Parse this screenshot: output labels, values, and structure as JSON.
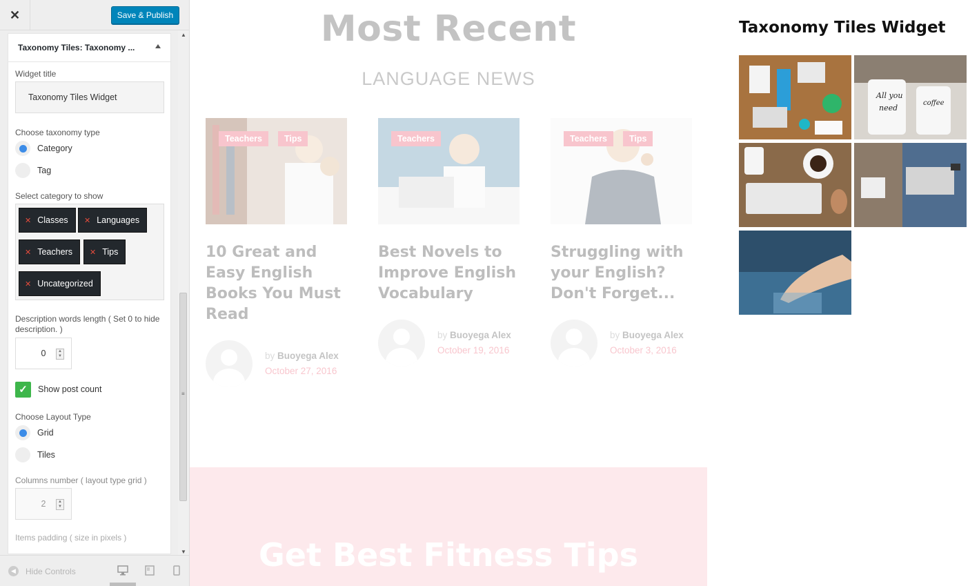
{
  "customizer": {
    "close_label": "✕",
    "save_label": "Save & Publish",
    "panel_title": "Taxonomy Tiles: Taxonomy ...",
    "widget_title_label": "Widget title",
    "widget_title_value": "Taxonomy Tiles Widget",
    "taxonomy_type_label": "Choose taxonomy type",
    "taxonomy_options": [
      "Category",
      "Tag"
    ],
    "taxonomy_selected": "Category",
    "select_category_label": "Select category to show",
    "categories": [
      "Classes",
      "Languages",
      "Teachers",
      "Tips",
      "Uncategorized"
    ],
    "desc_length_label": "Description words length ( Set 0 to hide description. )",
    "desc_length_value": "0",
    "show_post_count_label": "Show post count",
    "show_post_count": true,
    "layout_type_label": "Choose Layout Type",
    "layout_options": [
      "Grid",
      "Tiles"
    ],
    "layout_selected": "Grid",
    "columns_label": "Columns number ( layout type grid )",
    "columns_value": "2",
    "padding_label": "Items padding ( size in pixels )",
    "hide_controls_label": "Hide Controls"
  },
  "preview": {
    "heading": "Most Recent",
    "subheading": "LANGUAGE NEWS",
    "posts": [
      {
        "tags": [
          "Teachers",
          "Tips"
        ],
        "title": "10 Great and Easy English Books You Must Read",
        "by": "by",
        "author": "Buoyega Alex",
        "date": "October 27, 2016"
      },
      {
        "tags": [
          "Teachers"
        ],
        "title": "Best Novels to Improve English Vocabulary",
        "by": "by",
        "author": "Buoyega Alex",
        "date": "October 19, 2016"
      },
      {
        "tags": [
          "Teachers",
          "Tips"
        ],
        "title": "Struggling with your English? Don't Forget...",
        "by": "by",
        "author": "Buoyega Alex",
        "date": "October 3, 2016"
      }
    ],
    "banner_text": "Get Best Fitness Tips",
    "widget_heading": "Taxonomy Tiles Widget",
    "tiles": [
      "desk-workspace-photo",
      "coffee-mugs-photo",
      "keyboard-coffee-photo",
      "laptop-user-photo",
      "touchscreen-finger-photo"
    ]
  },
  "colors": {
    "accent_blue": "#0085ba",
    "tag_pink": "#ec5b6f",
    "chip_dark": "#23282d",
    "check_green": "#3eb64b"
  }
}
